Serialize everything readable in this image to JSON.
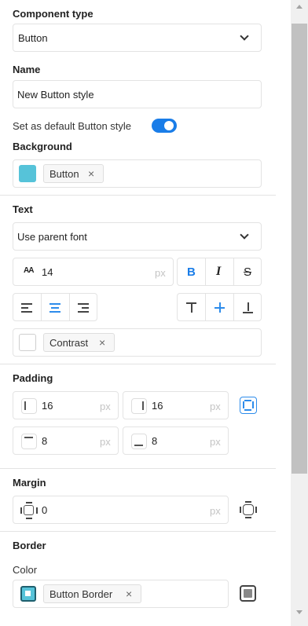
{
  "component_type": {
    "label": "Component type",
    "value": "Button"
  },
  "name": {
    "label": "Name",
    "value": "New Button style"
  },
  "default_toggle": {
    "label": "Set as default Button style",
    "on": true
  },
  "background": {
    "label": "Background",
    "swatch_color": "#56c3d9",
    "token": "Button"
  },
  "text": {
    "label": "Text",
    "font": "Use parent font",
    "font_size": "14",
    "font_size_unit": "px",
    "bold": "B",
    "italic": "I",
    "strike": "S",
    "color_token": "Contrast",
    "text_align_active": "center",
    "vertical_align_active": "middle"
  },
  "padding": {
    "label": "Padding",
    "left": "16",
    "right": "16",
    "top": "8",
    "bottom": "8",
    "unit": "px"
  },
  "margin": {
    "label": "Margin",
    "value": "0",
    "unit": "px"
  },
  "border": {
    "label": "Border",
    "color_label": "Color",
    "color_token": "Button Border",
    "swatch_color": "#56c3d9"
  },
  "colors": {
    "accent": "#1a7de8"
  }
}
